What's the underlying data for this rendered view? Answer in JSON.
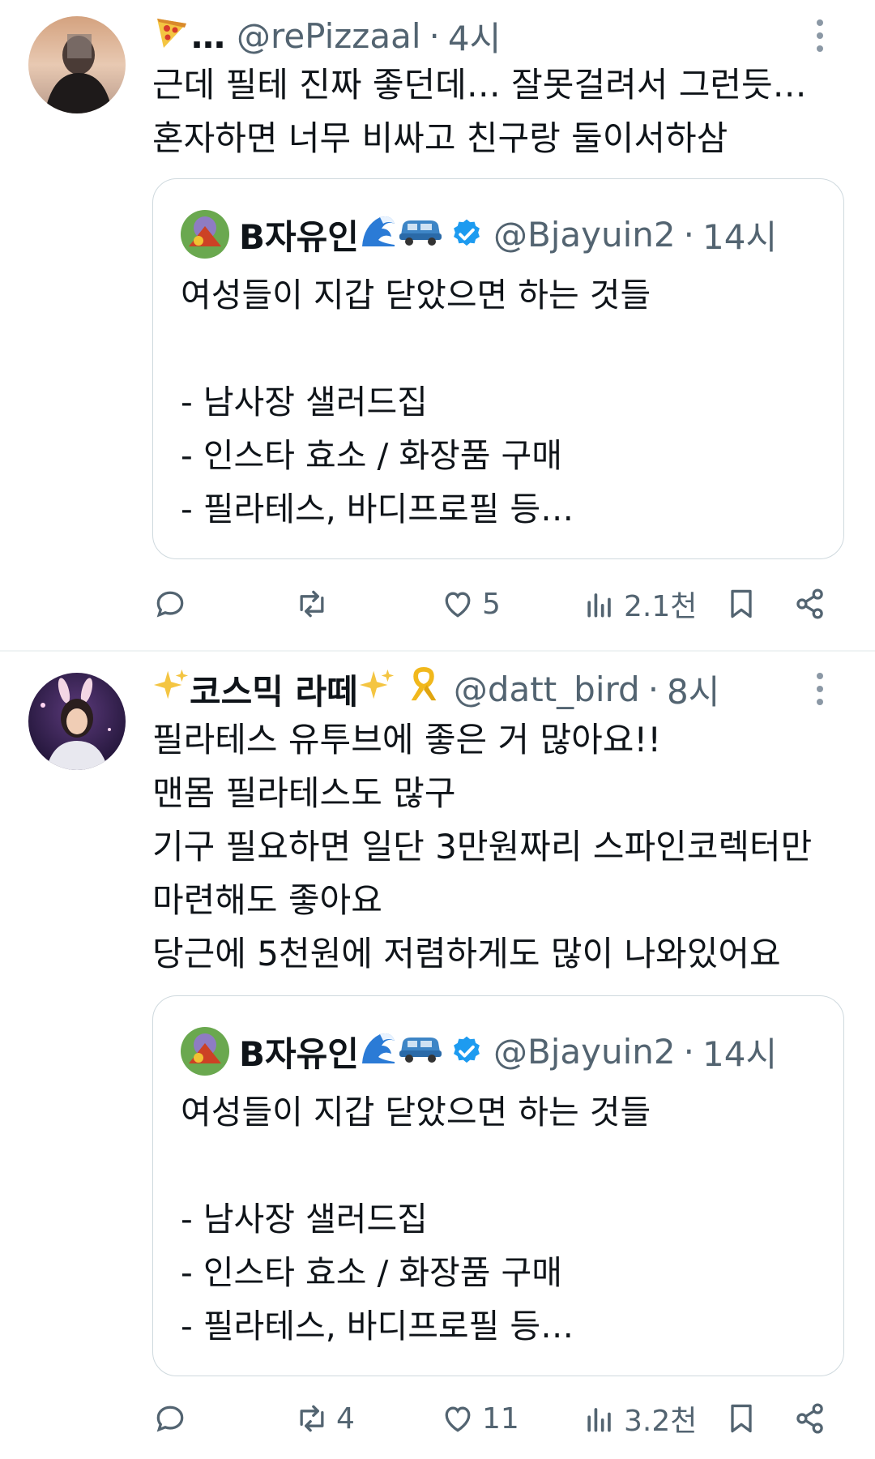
{
  "tweets": [
    {
      "name": "…",
      "handle": "@rePizzaal",
      "separator": "·",
      "time": "4시",
      "lines": [
        "근데 필테 진짜 좋던데… 잘못걸려서 그런듯…",
        "혼자하면 너무 비싸고 친구랑 둘이서하삼"
      ],
      "quote": {
        "name": "B자유인",
        "handle": "@Bjayuin2",
        "separator": "·",
        "time": "14시",
        "lines": [
          "여성들이 지갑 닫았으면 하는 것들",
          "",
          "- 남사장 샐러드집",
          "- 인스타 효소 / 화장품 구매",
          "- 필라테스, 바디프로필 등…"
        ]
      },
      "actions": {
        "reply": "",
        "retweet": "",
        "like": "5",
        "views": "2.1천"
      }
    },
    {
      "name": "코스믹 라떼",
      "handle": "@datt_bird",
      "separator": "·",
      "time": "8시",
      "lines": [
        "필라테스 유투브에 좋은 거 많아요!!",
        "맨몸 필라테스도 많구",
        "기구 필요하면 일단 3만원짜리 스파인코렉터만",
        "마련해도 좋아요",
        "당근에 5천원에 저렴하게도 많이 나와있어요"
      ],
      "quote": {
        "name": "B자유인",
        "handle": "@Bjayuin2",
        "separator": "·",
        "time": "14시",
        "lines": [
          "여성들이 지갑 닫았으면 하는 것들",
          "",
          "- 남사장 샐러드집",
          "- 인스타 효소 / 화장품 구매",
          "- 필라테스, 바디프로필 등…"
        ]
      },
      "actions": {
        "reply": "",
        "retweet": "4",
        "like": "11",
        "views": "3.2천"
      }
    }
  ],
  "icons": {
    "pizza": "pizza-emoji",
    "sparkles": "sparkles-emoji",
    "ribbon": "yellow-ribbon-emoji",
    "wave": "wave-emoji",
    "car": "car-emoji",
    "verified": "verified-badge-icon",
    "reply": "reply-icon",
    "retweet": "retweet-icon",
    "like": "heart-icon",
    "views": "views-icon",
    "bookmark": "bookmark-icon",
    "share": "share-icon"
  },
  "colors": {
    "accent": "#1d9bf0",
    "muted": "#536471",
    "border": "#cfd9de",
    "text": "#0f1419"
  }
}
